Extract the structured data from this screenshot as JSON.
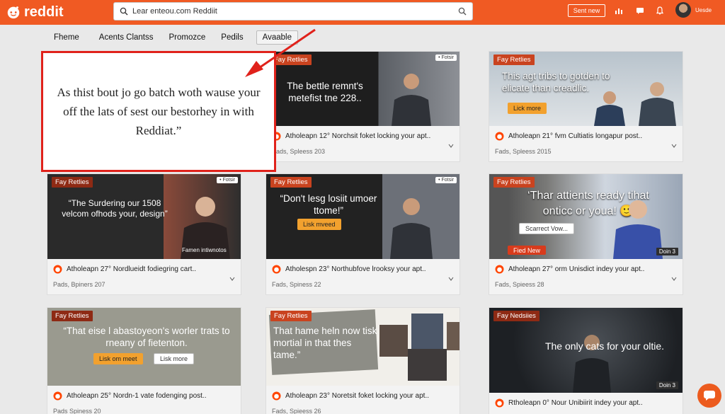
{
  "header": {
    "logo_text": "reddit",
    "search_value": "Lear enteou.com Reddiit",
    "sent_button": "Sent new",
    "user_label": "Uesde"
  },
  "nav": {
    "items": [
      "Fheme",
      "Acents Clantss",
      "Promozce",
      "Pedils",
      "Avaable"
    ]
  },
  "callout": {
    "text": "As thist bout jo go batch woth wause your off the lats of sest our bestorhey in with Reddiat.”"
  },
  "cards": [
    {
      "tag": "Fay Retlies",
      "headline": "The bettle remnt's metefist tne 228..",
      "meta": "Atholeapn 12° Norchsit foket locking your apt..",
      "sub": "Pads, Spleess 203"
    },
    {
      "tag": "Fay Retlies",
      "headline": "This agt tribs to gotden to elicate than creadlic.",
      "pill": "Lick more",
      "meta": "Atholeapn 21° fvm Cultiatis longapur post..",
      "sub": "Fads, Spleess 2015"
    },
    {
      "tag": "Fay Retlies",
      "headline": "“The Surdering our 1508 velcom ofhods your, design”",
      "mini": "• Fotsir",
      "caption": "Famen intiwnotos",
      "meta": "Atholeapn 27° Nordlueidt fodiegring cart..",
      "sub": "Pads, Bpiners 207"
    },
    {
      "tag": "Fay Retlies",
      "headline": "“Don't lesg losiit umoer ttome!”",
      "pill": "Lisk mveed",
      "mini": "• Fotsir",
      "meta": "Atholespn 23° Northubfove lrooksy your apt..",
      "sub": "Fads, Spiness 22"
    },
    {
      "tag": "Fay Retlies",
      "headline": "‘Thar attients ready tihat onticc or youa! 🙂",
      "pill": "Scarrect Vow...",
      "pill_red": "Fied New",
      "duration": "Doin 3",
      "meta": "Atholeapn 27° orm Unisdict indey your apt..",
      "sub": "Fads, Spieess 28"
    },
    {
      "tag": "Fay Retlies",
      "headline": "“That eise l abastoyeon's worler trats to rneany of fietenton.",
      "pill": "Lisk om meet",
      "pill2": "Lisk more",
      "meta": "Atholeapn 25° Nordn-1 vate fodenging post..",
      "sub": "Pads Spiness 20"
    },
    {
      "tag": "Fay Retlies",
      "headline": "That hame heln now tisk mortial in that thes tame.”",
      "meta": "Atholeapn 23° Noretsit foket locking your apt..",
      "sub": "Fads, Spieess 26"
    },
    {
      "tag": "Fay Nedsiies",
      "headline": "The only cats for your oltie.",
      "duration": "Doin 3",
      "meta": "Rtholeapn 0° Nour Unibiirit indey your apt..",
      "sub": ""
    }
  ]
}
